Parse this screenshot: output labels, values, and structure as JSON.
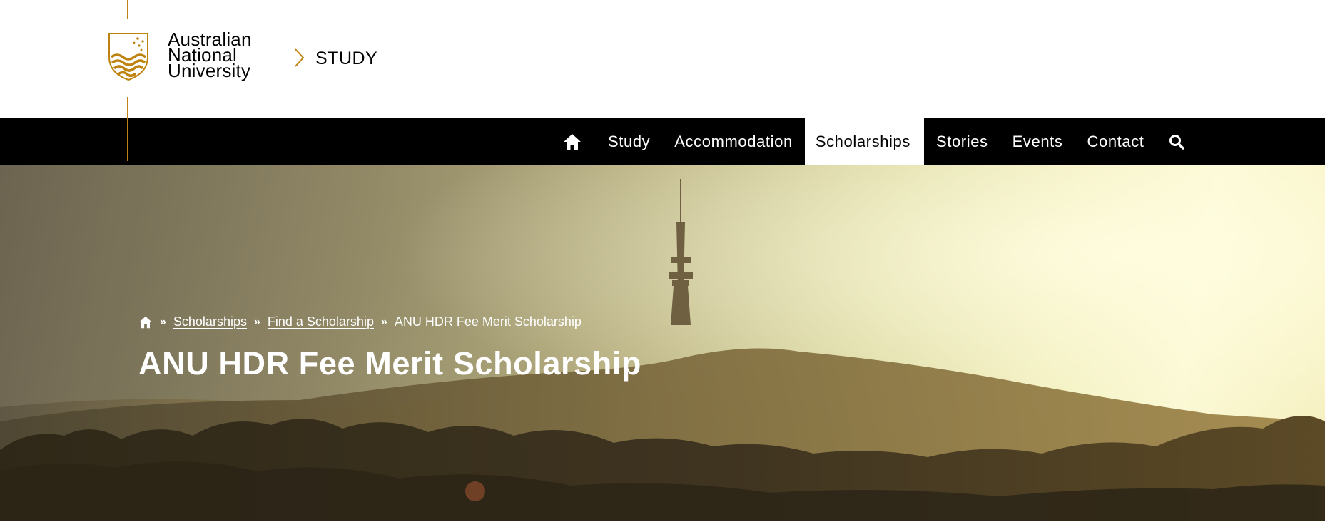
{
  "header": {
    "logo": {
      "line1": "Australian",
      "line2": "National",
      "line3": "University",
      "crest_icon": "anu-crest-icon"
    },
    "site_name": "STUDY",
    "chevron_icon": "chevron-right-icon"
  },
  "nav": {
    "home_icon": "home-icon",
    "items": [
      {
        "label": "Study"
      },
      {
        "label": "Accommodation"
      },
      {
        "label": "Scholarships",
        "active": true
      },
      {
        "label": "Stories"
      },
      {
        "label": "Events"
      },
      {
        "label": "Contact"
      }
    ],
    "search_icon": "search-icon"
  },
  "hero": {
    "breadcrumb": {
      "home_icon": "home-icon",
      "separator_icon": "double-chevron-right-icon",
      "items": [
        "Scholarships",
        "Find a Scholarship",
        "ANU HDR Fee Merit Scholarship"
      ]
    },
    "title": "ANU HDR Fee Merit Scholarship"
  },
  "colors": {
    "brand_gold": "#be830e",
    "nav_background": "#000000",
    "active_tab_background": "#ffffff"
  }
}
